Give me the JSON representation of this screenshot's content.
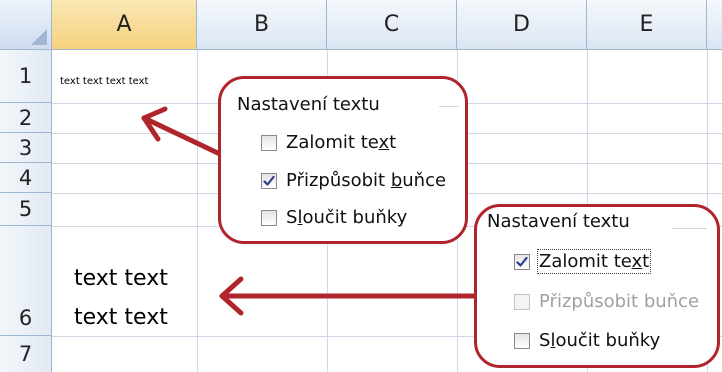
{
  "spreadsheet": {
    "columns": [
      "A",
      "B",
      "C",
      "D",
      "E"
    ],
    "rows": [
      "1",
      "2",
      "3",
      "4",
      "5",
      "6",
      "7"
    ],
    "cells": {
      "A1": "text text text text",
      "A6_line1": "text text",
      "A6_line2": "text text"
    }
  },
  "panel_top": {
    "title": "Nastavení textu",
    "wrap_text": {
      "label_before": "Zalomit te",
      "label_key": "x",
      "label_after": "t",
      "checked": false
    },
    "shrink_to_fit": {
      "label_before": "Přizpůsobit ",
      "label_key": "b",
      "label_after": "uňce",
      "checked": true
    },
    "merge_cells": {
      "label_before": "S",
      "label_key": "l",
      "label_after": "oučit buňky",
      "checked": false
    }
  },
  "panel_bottom": {
    "title": "Nastavení textu",
    "wrap_text": {
      "label_before": "Zalomit te",
      "label_key": "x",
      "label_after": "t",
      "checked": true
    },
    "shrink_to_fit": {
      "label": "Přizpůsobit buňce",
      "checked": false,
      "disabled": true
    },
    "merge_cells": {
      "label_before": "S",
      "label_key": "l",
      "label_after": "oučit buňky",
      "checked": false
    }
  },
  "colors": {
    "annotation_red": "#b0252b",
    "header_blue": "#dae5f2",
    "active_header": "#f6d27d",
    "gridline": "#d0d7e5"
  }
}
